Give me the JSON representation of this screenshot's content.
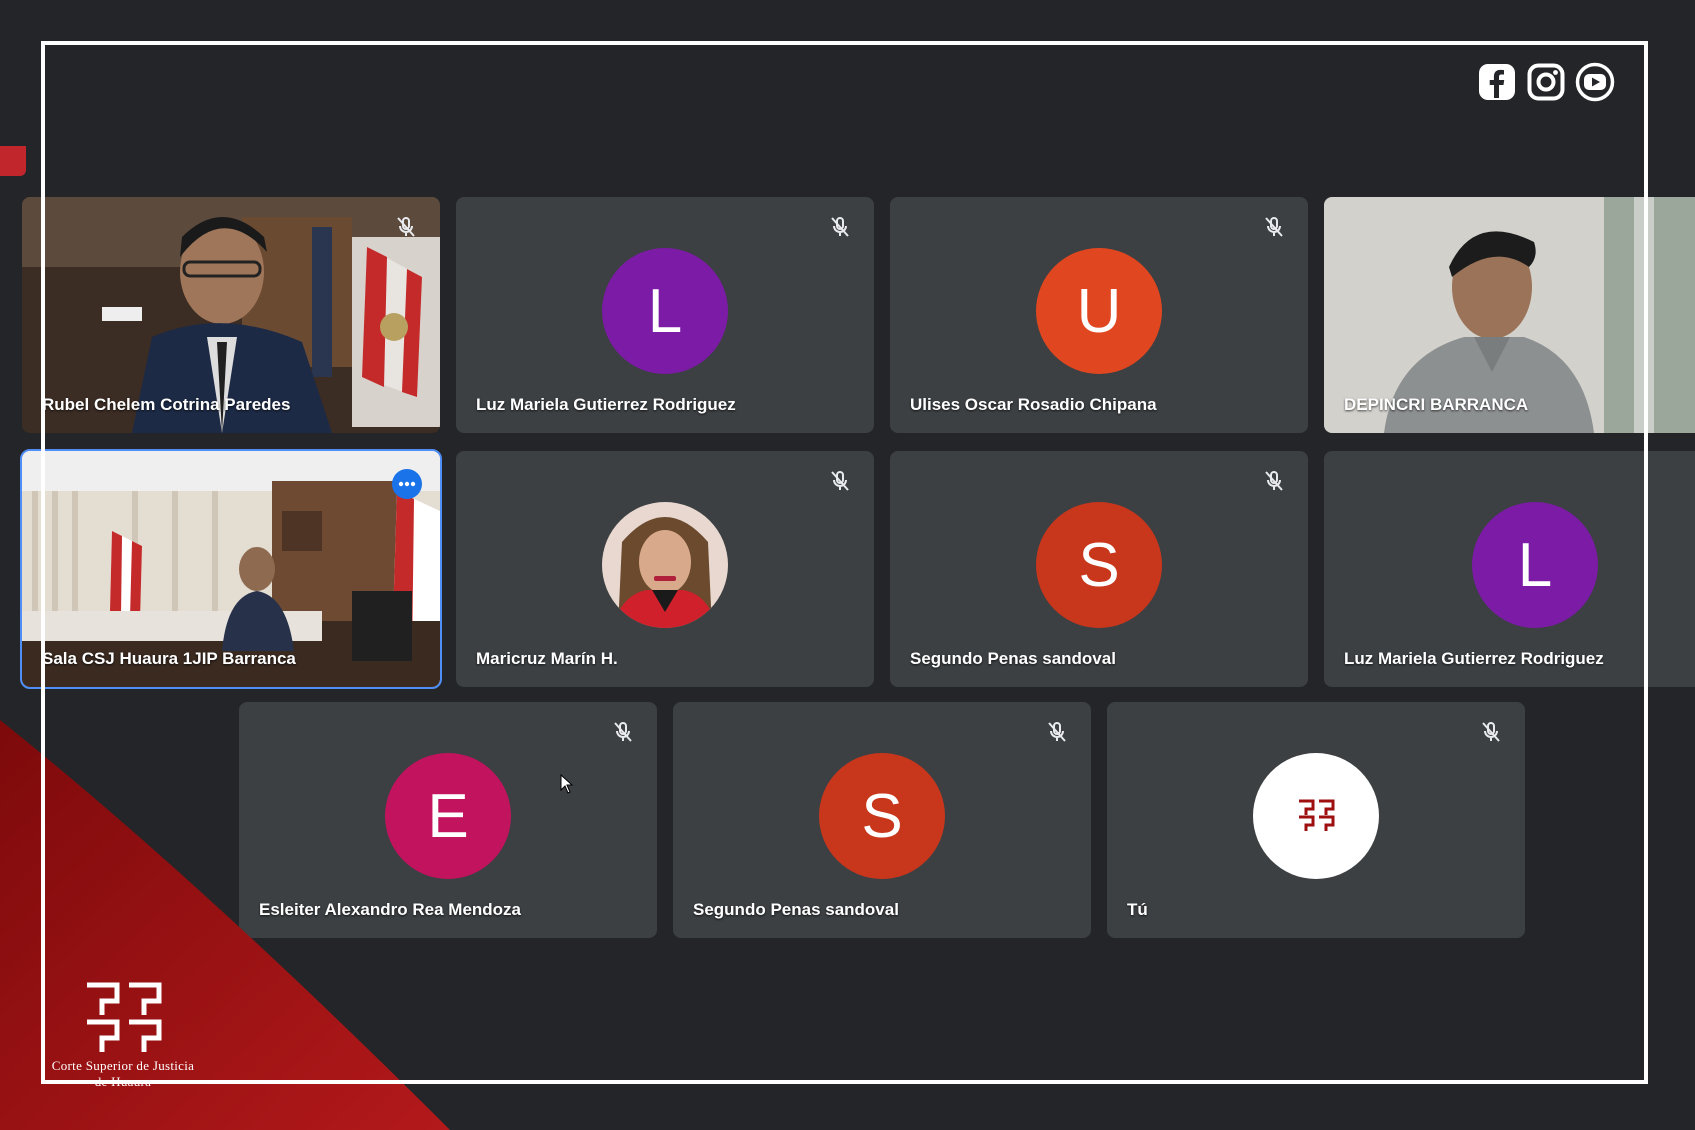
{
  "meeting": {
    "participants": [
      {
        "name": "Rubel Chelem Cotrina Paredes",
        "type": "video",
        "muted": true
      },
      {
        "name": "Luz Mariela Gutierrez Rodriguez",
        "type": "avatar",
        "initial": "L",
        "color": "#7b1ba6",
        "muted": true
      },
      {
        "name": "Ulises Oscar Rosadio Chipana",
        "type": "avatar",
        "initial": "U",
        "color": "#e0461f",
        "muted": true
      },
      {
        "name": "DEPINCRI BARRANCA",
        "type": "video",
        "muted": false
      },
      {
        "name": "Sala CSJ Huaura 1JIP Barranca",
        "type": "video",
        "muted": false,
        "active": true
      },
      {
        "name": "Maricruz Marín H.",
        "type": "photo",
        "muted": true
      },
      {
        "name": "Segundo Penas sandoval",
        "type": "avatar",
        "initial": "S",
        "color": "#c8361c",
        "muted": true
      },
      {
        "name": "Luz Mariela Gutierrez Rodriguez",
        "type": "avatar",
        "initial": "L",
        "color": "#7b1ba6",
        "muted": false
      },
      {
        "name": "Esleiter Alexandro Rea Mendoza",
        "type": "avatar",
        "initial": "E",
        "color": "#c2135f",
        "muted": true
      },
      {
        "name": "Segundo Penas sandoval",
        "type": "avatar",
        "initial": "S",
        "color": "#c8361c",
        "muted": true
      },
      {
        "name": "Tú",
        "type": "logo",
        "muted": true
      }
    ]
  },
  "social_icons": [
    "facebook-icon",
    "instagram-icon",
    "youtube-icon"
  ],
  "branding": {
    "org_line1": "Corte Superior de Justicia",
    "org_line2": "de Huaura",
    "accent_color": "#9e0f10"
  }
}
